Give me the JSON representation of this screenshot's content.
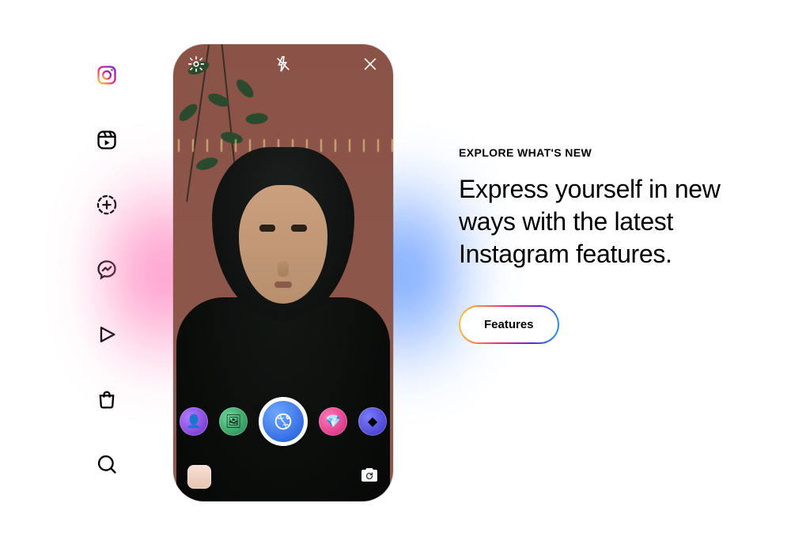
{
  "sidebar": {
    "items": [
      {
        "name": "instagram-icon"
      },
      {
        "name": "reels-icon"
      },
      {
        "name": "create-icon"
      },
      {
        "name": "messenger-icon"
      },
      {
        "name": "play-icon"
      },
      {
        "name": "shop-icon"
      },
      {
        "name": "search-icon"
      }
    ]
  },
  "phone": {
    "top_controls": {
      "settings": "settings",
      "flash_off": "flash-off",
      "close": "close"
    },
    "filters": [
      {
        "name": "filter-1",
        "color": "f-purple",
        "glyph": "👤"
      },
      {
        "name": "filter-2",
        "color": "f-green",
        "glyph": "🖼"
      },
      {
        "name": "filter-4",
        "color": "f-pink",
        "glyph": "💎"
      },
      {
        "name": "filter-5",
        "color": "f-indigo",
        "glyph": "◆"
      }
    ],
    "shutter": "capture",
    "gallery_thumb": "last-photo",
    "switch_camera": "switch-camera"
  },
  "promo": {
    "eyebrow": "EXPLORE WHAT'S NEW",
    "headline": "Express yourself in new ways with the latest Instagram features.",
    "cta_label": "Features"
  },
  "colors": {
    "gradient": [
      "#f9ce34",
      "#ee2a7b",
      "#6228d7",
      "#1da1f2"
    ]
  }
}
